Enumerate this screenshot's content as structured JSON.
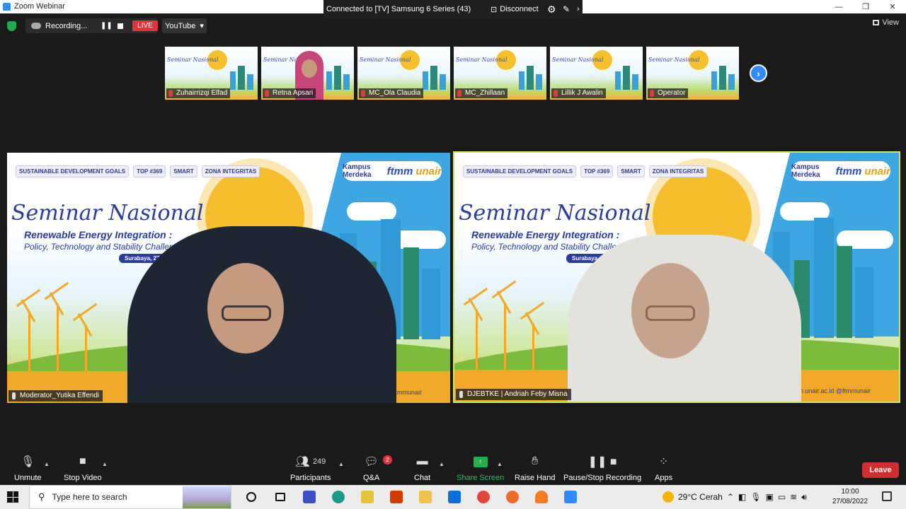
{
  "window": {
    "title": "Zoom Webinar",
    "controls": [
      "—",
      "❐",
      "✕"
    ]
  },
  "share_bar": {
    "connected": "Connected to [TV] Samsung 6 Series (43)",
    "disconnect": "Disconnect"
  },
  "recording": {
    "label": "Recording...",
    "live": "LIVE",
    "stream": "YouTube"
  },
  "view": {
    "label": "View"
  },
  "thumbnails": [
    {
      "name": "Zuhairrizqi Elfad"
    },
    {
      "name": "Retna Apsari"
    },
    {
      "name": "MC_Ola Claudia"
    },
    {
      "name": "MC_Zhillaan"
    },
    {
      "name": "Lillik J Awalin"
    },
    {
      "name": "Operator"
    }
  ],
  "slide": {
    "title": "Seminar Nasional",
    "subtitle": "Renewable Energy Integration :",
    "tagline": "Policy, Technology and  Stability Challenge",
    "date": "Surabaya, 27 Agustus 2022",
    "brand_kampus": "Kampus Merdeka",
    "brand_fm": "ftmm",
    "brand_un": "unair",
    "logo_goals": "SUSTAINABLE DEVELOPMENT GOALS",
    "logo_top": "TOP #369",
    "logo_smart": "SMART",
    "logo_integritas": "ZONA INTEGRITAS",
    "social": "@ftmmunair",
    "social_right": "ftmm.unair.ac.id  @ftmmunair"
  },
  "speakers": {
    "left": "Moderator_Yutika Effendi",
    "right": "DJEBTKE | Andriah Feby Misna"
  },
  "toolbar": {
    "unmute": "Unmute",
    "stop_video": "Stop Video",
    "participants": "Participants",
    "participants_count": "249",
    "qa": "Q&A",
    "qa_badge": "2",
    "chat": "Chat",
    "share": "Share Screen",
    "raise_hand": "Raise Hand",
    "pause_rec": "Pause/Stop Recording",
    "apps": "Apps",
    "leave": "Leave"
  },
  "taskbar": {
    "search_placeholder": "Type here to search",
    "weather": "29°C  Cerah",
    "time": "10:00",
    "date": "27/08/2022"
  }
}
